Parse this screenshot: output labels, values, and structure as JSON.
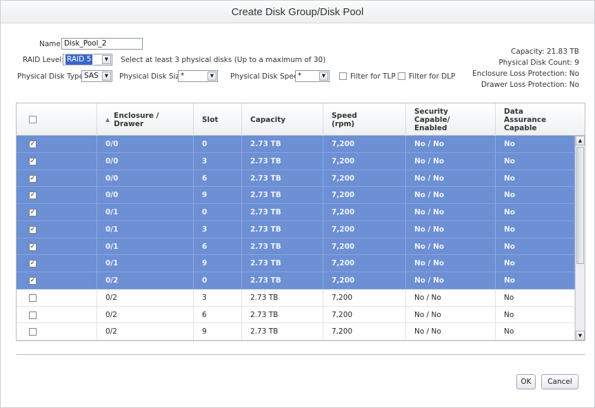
{
  "title": "Create Disk Group/Disk Pool",
  "form": {
    "name_label": "Name:",
    "name_value": "Disk_Pool_2",
    "raid_label": "RAID Level:",
    "raid_value": "RAID 5",
    "raid_hint": "Select at least 3 physical disks (Up to a maximum of 30)",
    "disk_type_label": "Physical Disk Type:",
    "disk_type_value": "SAS",
    "disk_size_label": "Physical Disk Size:",
    "disk_size_value": "*",
    "disk_speed_label": "Physical Disk Speed:",
    "disk_speed_value": "*",
    "filter_tlp_label": "Filter for TLP",
    "filter_dlp_label": "Filter for DLP"
  },
  "summary": {
    "capacity": "Capacity: 21.83 TB",
    "disk_count": "Physical Disk Count: 9",
    "enclosure_loss": "Enclosure Loss Protection: No",
    "drawer_loss": "Drawer Loss Protection: No"
  },
  "table": {
    "headers": {
      "enclosure": "Enclosure / Drawer",
      "slot": "Slot",
      "capacity": "Capacity",
      "speed": "Speed (rpm)",
      "security": "Security Capable/ Enabled",
      "data_assurance": "Data Assurance Capable"
    },
    "rows": [
      {
        "checked": true,
        "enclosure": "0/0",
        "slot": "0",
        "capacity": "2.73 TB",
        "speed": "7,200",
        "security": "No / No",
        "da": "No"
      },
      {
        "checked": true,
        "enclosure": "0/0",
        "slot": "3",
        "capacity": "2.73 TB",
        "speed": "7,200",
        "security": "No / No",
        "da": "No"
      },
      {
        "checked": true,
        "enclosure": "0/0",
        "slot": "6",
        "capacity": "2.73 TB",
        "speed": "7,200",
        "security": "No / No",
        "da": "No"
      },
      {
        "checked": true,
        "enclosure": "0/0",
        "slot": "9",
        "capacity": "2.73 TB",
        "speed": "7,200",
        "security": "No / No",
        "da": "No"
      },
      {
        "checked": true,
        "enclosure": "0/1",
        "slot": "0",
        "capacity": "2.73 TB",
        "speed": "7,200",
        "security": "No / No",
        "da": "No"
      },
      {
        "checked": true,
        "enclosure": "0/1",
        "slot": "3",
        "capacity": "2.73 TB",
        "speed": "7,200",
        "security": "No / No",
        "da": "No"
      },
      {
        "checked": true,
        "enclosure": "0/1",
        "slot": "6",
        "capacity": "2.73 TB",
        "speed": "7,200",
        "security": "No / No",
        "da": "No"
      },
      {
        "checked": true,
        "enclosure": "0/1",
        "slot": "9",
        "capacity": "2.73 TB",
        "speed": "7,200",
        "security": "No / No",
        "da": "No"
      },
      {
        "checked": true,
        "enclosure": "0/2",
        "slot": "0",
        "capacity": "2.73 TB",
        "speed": "7,200",
        "security": "No / No",
        "da": "No"
      },
      {
        "checked": false,
        "enclosure": "0/2",
        "slot": "3",
        "capacity": "2.73 TB",
        "speed": "7,200",
        "security": "No / No",
        "da": "No"
      },
      {
        "checked": false,
        "enclosure": "0/2",
        "slot": "6",
        "capacity": "2.73 TB",
        "speed": "7,200",
        "security": "No / No",
        "da": "No"
      },
      {
        "checked": false,
        "enclosure": "0/2",
        "slot": "9",
        "capacity": "2.73 TB",
        "speed": "7,200",
        "security": "No / No",
        "da": "No"
      }
    ]
  },
  "buttons": {
    "ok": "OK",
    "cancel": "Cancel"
  },
  "colors": {
    "selected_row": "#6d8fd4",
    "title_text": "#333333"
  }
}
